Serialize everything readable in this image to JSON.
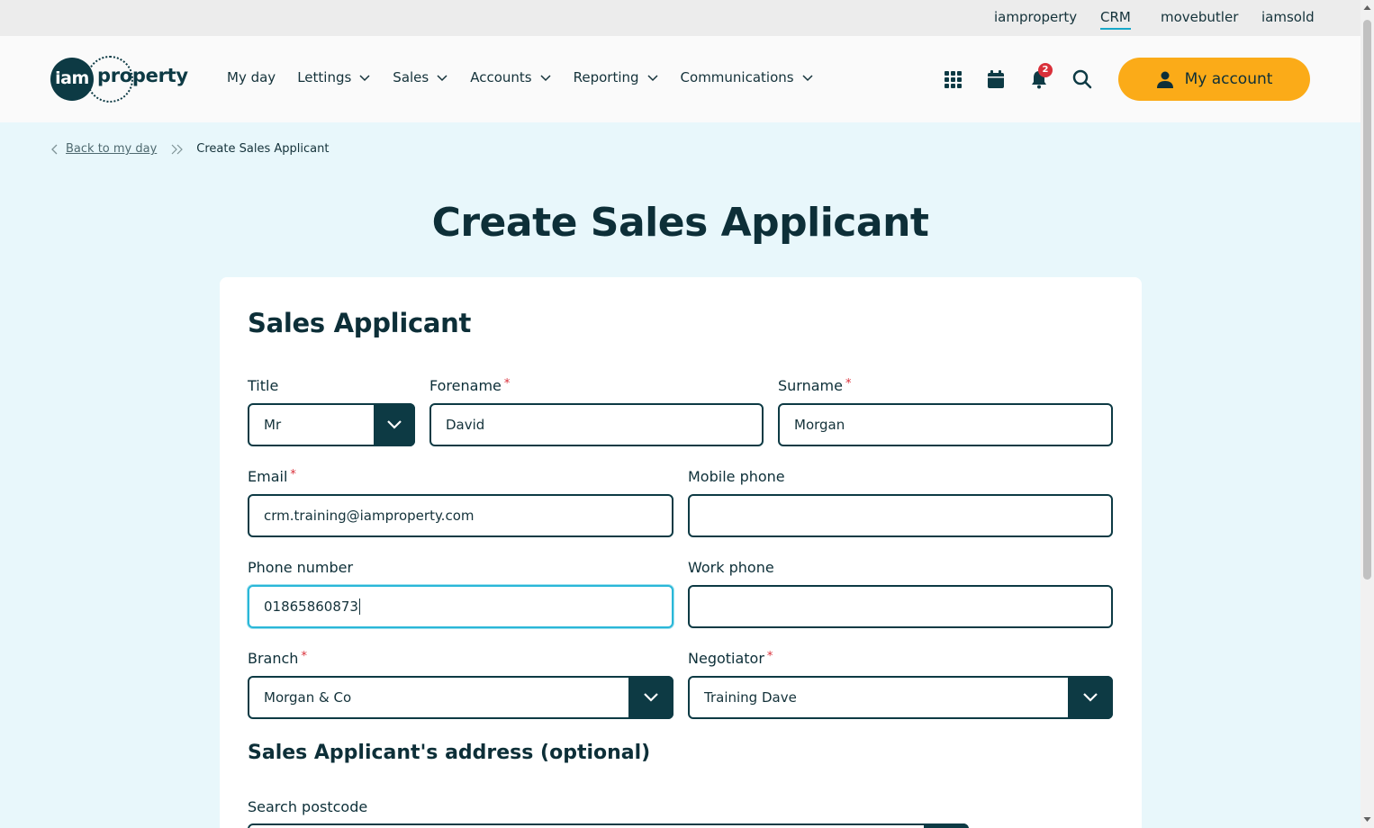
{
  "brand_links": [
    "iamproperty",
    "CRM",
    "movebutler",
    "iamsold"
  ],
  "logo": {
    "circle_text": "iam",
    "text": "property"
  },
  "nav": {
    "items": [
      {
        "label": "My day",
        "dropdown": false
      },
      {
        "label": "Lettings",
        "dropdown": true
      },
      {
        "label": "Sales",
        "dropdown": true
      },
      {
        "label": "Accounts",
        "dropdown": true
      },
      {
        "label": "Reporting",
        "dropdown": true
      },
      {
        "label": "Communications",
        "dropdown": true
      }
    ]
  },
  "header": {
    "notification_count": "2",
    "account_label": "My account",
    "accent_color": "#fbab18"
  },
  "breadcrumb": {
    "back_label": "Back to my day",
    "current": "Create Sales Applicant"
  },
  "page_title": "Create Sales Applicant",
  "form": {
    "section_title": "Sales Applicant",
    "title": {
      "label": "Title",
      "value": "Mr"
    },
    "forename": {
      "label": "Forename",
      "value": "David"
    },
    "surname": {
      "label": "Surname",
      "value": "Morgan"
    },
    "email": {
      "label": "Email",
      "value": "crm.training@iamproperty.com"
    },
    "mobile_phone": {
      "label": "Mobile phone",
      "value": ""
    },
    "phone_number": {
      "label": "Phone number",
      "value": "01865860873"
    },
    "work_phone": {
      "label": "Work phone",
      "value": ""
    },
    "branch": {
      "label": "Branch",
      "value": "Morgan & Co"
    },
    "negotiator": {
      "label": "Negotiator",
      "value": "Training Dave"
    },
    "required_mark": "*",
    "address_section_title": "Sales Applicant's address (optional)",
    "search_postcode_label": "Search postcode"
  }
}
